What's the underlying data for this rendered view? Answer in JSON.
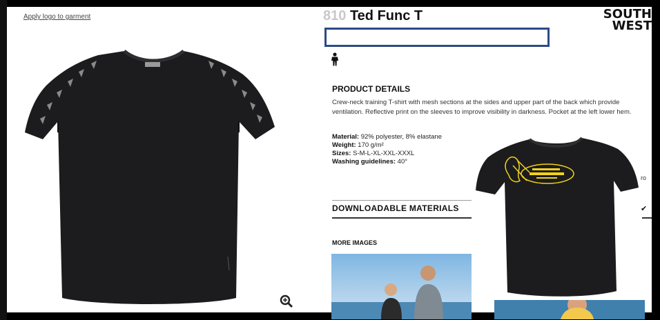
{
  "page": {
    "apply_logo_link": "Apply logo to garment",
    "product": {
      "code": "810",
      "name": "Ted Func T",
      "brand_line1": "SOUTH",
      "brand_line2": "WEST"
    },
    "details": {
      "heading": "PRODUCT DETAILS",
      "description": "Crew-neck training T-shirt with mesh sections at the sides and upper part of the back which provide ventilation. Reflective print on the sleeves to improve visibility in darkness. Pocket at the left lower hem.",
      "material_label": "Material:",
      "material_value": " 92% polyester, 8% elastane",
      "weight_label": "Weight:",
      "weight_value": " 170 g/m²",
      "sizes_label": "Sizes:",
      "sizes_value": " S-M-L-XL-XXL-XXXL",
      "washing_label": "Washing guidelines:",
      "washing_value": " 40°"
    },
    "downloads_heading": "DOWNLOADABLE MATERIALS",
    "more_images_heading": "MORE IMAGES",
    "right_edge_text": "ro"
  },
  "colors": {
    "shirt": "#1c1c1e",
    "blue_box_border": "#2b4a86",
    "logo_print": "#f2d21a"
  },
  "icons": [
    "person-icon",
    "zoom-in-icon",
    "checkmark-icon"
  ]
}
